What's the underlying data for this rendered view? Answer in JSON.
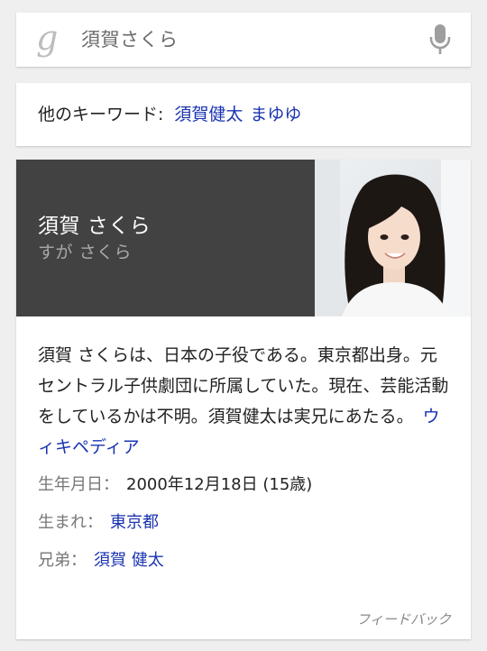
{
  "search": {
    "logo": "g",
    "query": "須賀さくら",
    "mic_icon": "mic-icon"
  },
  "keywords": {
    "label": "他のキーワード:",
    "links": [
      "須賀健太",
      "まゆゆ"
    ]
  },
  "knowledge": {
    "name": "須賀 さくら",
    "reading": "すが さくら",
    "photo": "portrait-photo",
    "description": "須賀 さくらは、日本の子役である。東京都出身。元セントラル子供劇団に所属していた。現在、芸能活動をしているかは不明。須賀健太は実兄にあたる。",
    "source_link": "ウィキペディア",
    "facts": {
      "birth_label": "生年月日：",
      "birth_value": "2000年12月18日 (15歳)",
      "born_label": "生まれ：",
      "born_value": "東京都",
      "sibling_label": "兄弟：",
      "sibling_value": "須賀 健太"
    },
    "feedback": "フィードバック"
  },
  "colors": {
    "background": "#efefef",
    "card": "#ffffff",
    "header": "#424242",
    "link": "#1a33b2",
    "muted": "#777777"
  }
}
